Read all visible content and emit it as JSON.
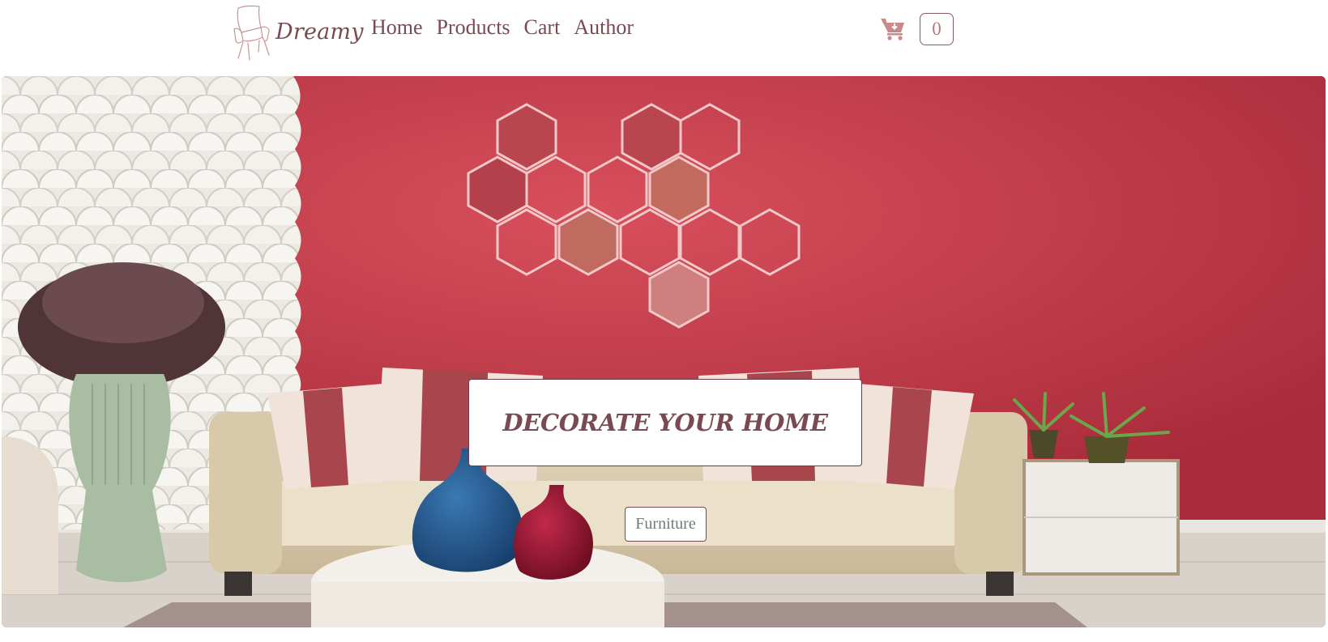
{
  "brand": {
    "name": "Dreamy",
    "logo_icon": "armchair-icon"
  },
  "nav": {
    "items": [
      {
        "label": "Home"
      },
      {
        "label": "Products"
      },
      {
        "label": "Cart"
      },
      {
        "label": "Author"
      }
    ]
  },
  "cart": {
    "icon": "cart-download-icon",
    "count": "0"
  },
  "hero": {
    "tagline": "DECORATE YOUR HOME",
    "button_label": "Furniture",
    "image": "living-room-photo"
  },
  "colors": {
    "brand": "#7a4a52",
    "cart_icon": "#c98a8c",
    "wall_red": "#c8434f",
    "button_text": "#6a7d7a"
  }
}
